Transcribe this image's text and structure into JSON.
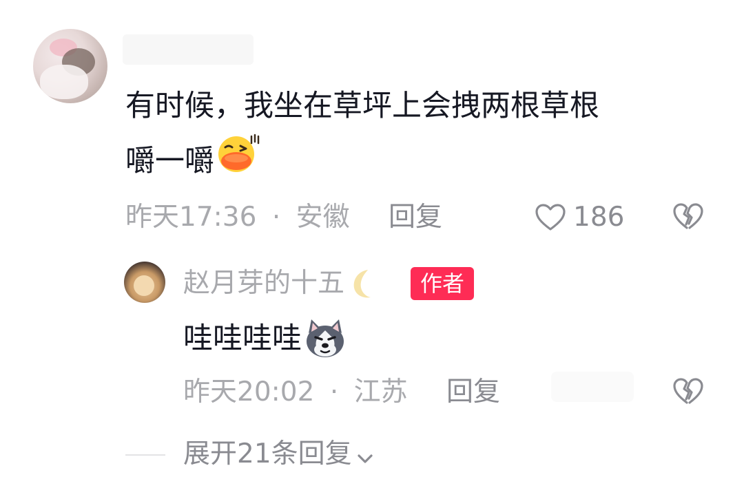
{
  "comment": {
    "text_line1": "有时候，我坐在草坪上会拽两根草根",
    "text_line2": "嚼一嚼",
    "emoji_icon": "duck-lips-emoji",
    "time": "昨天17:36",
    "separator": "·",
    "location": "安徽",
    "reply_label": "回复",
    "like_count": "186"
  },
  "reply": {
    "username": "赵月芽的十五",
    "name_emoji_icon": "crescent-moon-emoji",
    "badge": "作者",
    "text": "哇哇哇哇",
    "emoji_icon": "husky-dog-emoji",
    "time": "昨天20:02",
    "separator": "·",
    "location": "江苏",
    "reply_label": "回复"
  },
  "expand": {
    "label": "展开21条回复",
    "icon": "chevron-down-icon"
  },
  "colors": {
    "badge_bg": "#fe2c55",
    "meta_text": "#a8a9ad",
    "body_text": "#161823"
  }
}
